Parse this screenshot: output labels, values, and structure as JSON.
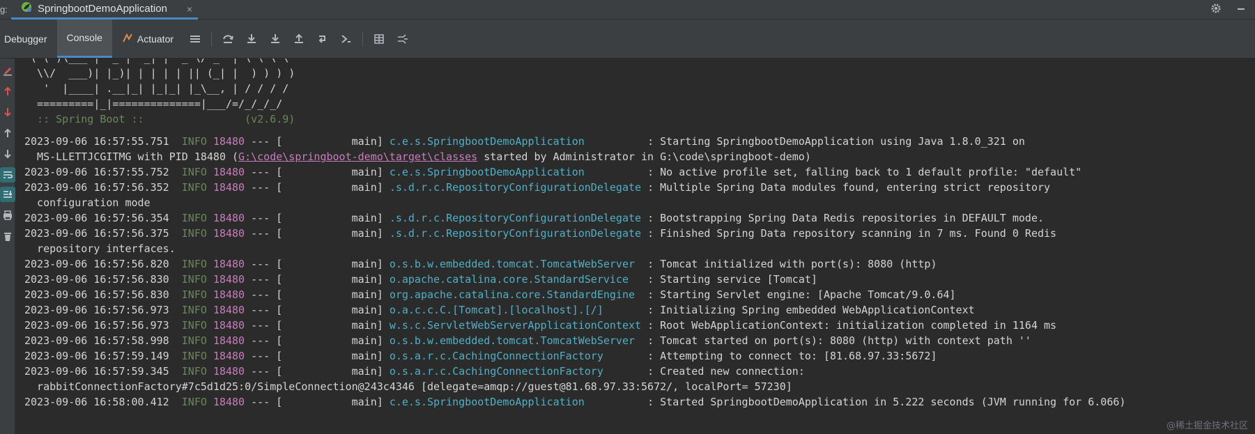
{
  "tab_strip": {
    "prefix": "g:",
    "run_tab_label": "SpringbootDemoApplication",
    "close_glyph": "×",
    "icons": [
      "gear-icon",
      "minimize-icon"
    ]
  },
  "toolbar": {
    "tabs": [
      "Debugger",
      "Console",
      "Actuator"
    ],
    "active_tab": "Console",
    "buttons": [
      "menu-icon",
      "step-over-icon",
      "step-into-icon",
      "force-step-into-icon",
      "step-out-icon",
      "run-to-cursor-icon",
      "evaluate-icon",
      "table-icon",
      "streams-icon"
    ]
  },
  "gutter": {
    "buttons": [
      "edit-icon",
      "up-red-icon",
      "down-red-icon",
      "up-icon",
      "down-icon",
      "soft-wrap-icon",
      "scroll-to-end-icon",
      "print-icon",
      "trash-icon"
    ]
  },
  "banner": {
    "lines": [
      " ( ( )\\___ | '_ | '_| | '_ \\/ _` | \\ \\ \\ \\",
      "  \\\\/  ___)| |_)| | | | | || (_| |  ) ) ) )",
      "   '  |____| .__|_| |_|_| |_\\__, | / / / /",
      "  =========|_|==============|___/=/_/_/_/"
    ],
    "boot_line": "  :: Spring Boot ::                (v2.6.9)"
  },
  "logs": [
    {
      "ts": "2023-09-06 16:57:55.751",
      "level": "INFO",
      "pid": "18480",
      "sep": "---",
      "thread": "[           main]",
      "logger": "c.e.s.SpringbootDemoApplication         ",
      "msg": " : Starting SpringbootDemoApplication using Java 1.8.0_321 on"
    },
    {
      "cont_pre": "  MS-LLETTJCGITMG with PID 18480 (",
      "link": "G:\\code\\springboot-demo\\target\\classes",
      "cont_post": " started by Administrator in G:\\code\\springboot-demo)"
    },
    {
      "ts": "2023-09-06 16:57:55.752",
      "level": "INFO",
      "pid": "18480",
      "sep": "---",
      "thread": "[           main]",
      "logger": "c.e.s.SpringbootDemoApplication         ",
      "msg": " : No active profile set, falling back to 1 default profile: \"default\""
    },
    {
      "ts": "2023-09-06 16:57:56.352",
      "level": "INFO",
      "pid": "18480",
      "sep": "---",
      "thread": "[           main]",
      "logger": ".s.d.r.c.RepositoryConfigurationDelegate",
      "msg": " : Multiple Spring Data modules found, entering strict repository"
    },
    {
      "cont": "  configuration mode"
    },
    {
      "ts": "2023-09-06 16:57:56.354",
      "level": "INFO",
      "pid": "18480",
      "sep": "---",
      "thread": "[           main]",
      "logger": ".s.d.r.c.RepositoryConfigurationDelegate",
      "msg": " : Bootstrapping Spring Data Redis repositories in DEFAULT mode."
    },
    {
      "ts": "2023-09-06 16:57:56.375",
      "level": "INFO",
      "pid": "18480",
      "sep": "---",
      "thread": "[           main]",
      "logger": ".s.d.r.c.RepositoryConfigurationDelegate",
      "msg": " : Finished Spring Data repository scanning in 7 ms. Found 0 Redis"
    },
    {
      "cont": "  repository interfaces."
    },
    {
      "ts": "2023-09-06 16:57:56.820",
      "level": "INFO",
      "pid": "18480",
      "sep": "---",
      "thread": "[           main]",
      "logger": "o.s.b.w.embedded.tomcat.TomcatWebServer ",
      "msg": " : Tomcat initialized with port(s): 8080 (http)"
    },
    {
      "ts": "2023-09-06 16:57:56.830",
      "level": "INFO",
      "pid": "18480",
      "sep": "---",
      "thread": "[           main]",
      "logger": "o.apache.catalina.core.StandardService  ",
      "msg": " : Starting service [Tomcat]"
    },
    {
      "ts": "2023-09-06 16:57:56.830",
      "level": "INFO",
      "pid": "18480",
      "sep": "---",
      "thread": "[           main]",
      "logger": "org.apache.catalina.core.StandardEngine ",
      "msg": " : Starting Servlet engine: [Apache Tomcat/9.0.64]"
    },
    {
      "ts": "2023-09-06 16:57:56.973",
      "level": "INFO",
      "pid": "18480",
      "sep": "---",
      "thread": "[           main]",
      "logger": "o.a.c.c.C.[Tomcat].[localhost].[/]      ",
      "msg": " : Initializing Spring embedded WebApplicationContext"
    },
    {
      "ts": "2023-09-06 16:57:56.973",
      "level": "INFO",
      "pid": "18480",
      "sep": "---",
      "thread": "[           main]",
      "logger": "w.s.c.ServletWebServerApplicationContext",
      "msg": " : Root WebApplicationContext: initialization completed in 1164 ms"
    },
    {
      "ts": "2023-09-06 16:57:58.998",
      "level": "INFO",
      "pid": "18480",
      "sep": "---",
      "thread": "[           main]",
      "logger": "o.s.b.w.embedded.tomcat.TomcatWebServer ",
      "msg": " : Tomcat started on port(s): 8080 (http) with context path ''"
    },
    {
      "ts": "2023-09-06 16:57:59.149",
      "level": "INFO",
      "pid": "18480",
      "sep": "---",
      "thread": "[           main]",
      "logger": "o.s.a.r.c.CachingConnectionFactory      ",
      "msg": " : Attempting to connect to: [81.68.97.33:5672]"
    },
    {
      "ts": "2023-09-06 16:57:59.345",
      "level": "INFO",
      "pid": "18480",
      "sep": "---",
      "thread": "[           main]",
      "logger": "o.s.a.r.c.CachingConnectionFactory      ",
      "msg": " : Created new connection:"
    },
    {
      "cont": "  rabbitConnectionFactory#7c5d1d25:0/SimpleConnection@243c4346 [delegate=amqp://guest@81.68.97.33:5672/, localPort= 57230]"
    },
    {
      "ts": "2023-09-06 16:58:00.412",
      "level": "INFO",
      "pid": "18480",
      "sep": "---",
      "thread": "[           main]",
      "logger": "c.e.s.SpringbootDemoApplication         ",
      "msg": " : Started SpringbootDemoApplication in 5.222 seconds (JVM running for 6.066)"
    }
  ],
  "watermark": "@稀土掘金技术社区"
}
